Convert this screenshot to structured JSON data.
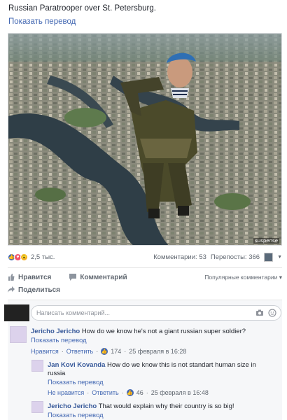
{
  "post": {
    "caption": "Russian Paratrooper over St. Petersburg.",
    "translate_link": "Показать перевод",
    "photo_watermark": "suspense"
  },
  "stats": {
    "reaction_count": "2,5 тыс.",
    "comments": "Комментарии: 53",
    "shares": "Перепосты: 366"
  },
  "actions": {
    "like": "Нравится",
    "comment": "Комментарий",
    "share": "Поделиться",
    "sort": "Популярные комментарии"
  },
  "composer": {
    "placeholder": "Написать комментарий..."
  },
  "comments": [
    {
      "author": "Jericho Jericho",
      "text": "How do we know he's not a giant russian super soldier?",
      "translate": "Показать перевод",
      "like": "Нравится",
      "reply": "Ответить",
      "likes": "174",
      "time": "25 февраля в 16:28"
    },
    {
      "author": "Jan Kovi Kovanda",
      "text_line1": "How do we know this is not standart human size in",
      "text_line2": "russia",
      "translate": "Показать перевод",
      "like": "Не нравится",
      "reply": "Ответить",
      "likes": "46",
      "time": "25 февраля в 16:48"
    },
    {
      "author": "Jericho Jericho",
      "text": "That would explain why their country is so big!",
      "translate": "Показать перевод"
    }
  ],
  "colors": {
    "link": "#4267b2",
    "name": "#365899",
    "muted": "#606770"
  }
}
